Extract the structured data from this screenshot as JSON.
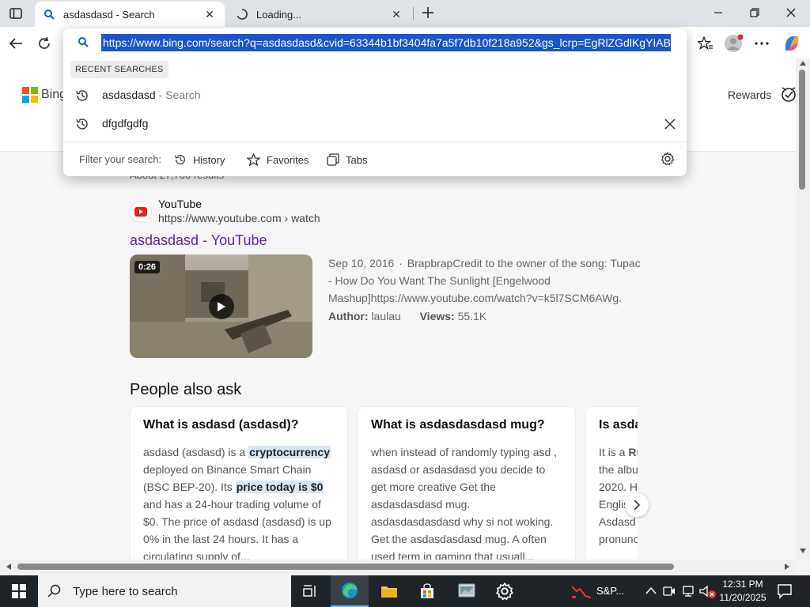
{
  "tabs": [
    {
      "title": "asdasdasd - Search",
      "active": true
    },
    {
      "title": "Loading...",
      "active": false
    }
  ],
  "omnibox": {
    "url": "https://www.bing.com/search?q=asdasdasd&cvid=63344b1bf3404fa7a5f7db10f218a952&gs_lcrp=EgRlZGdlKgYIABB",
    "recent_label": "RECENT SEARCHES",
    "suggestions": [
      {
        "text": "asdasdasd",
        "sub": " - Search"
      },
      {
        "text": "dfgdfgdfg",
        "sub": ""
      }
    ],
    "filter_label": "Filter your search:",
    "filters": [
      "History",
      "Favorites",
      "Tabs"
    ]
  },
  "bing": {
    "logo_text": "Bing",
    "rewards": "Rewards",
    "result_count": "About 27,700 results"
  },
  "result": {
    "site_name": "YouTube",
    "url": "https://www.youtube.com › watch",
    "title": "asdasdasd - YouTube",
    "duration": "0:26",
    "date": "Sep 10, 2016",
    "snippet": "BrapbrapCredit to the owner of the song: Tupac - How Do You Want The Sunlight [Engelwood Mashup]https://www.youtube.com/watch?v=k5l7SCM6AWg.",
    "author_label": "Author:",
    "author": "laulau",
    "views_label": "Views:",
    "views": "55.1K"
  },
  "paa": {
    "heading": "People also ask",
    "cards": [
      {
        "question": "What is asdasd (asdasd)?",
        "a1": "asdasd (asdasd) is a ",
        "h1": "cryptocurrency",
        "a2": " deployed on Binance Smart Chain (BSC BEP-20). Its ",
        "h2": "price today is $0",
        "a3": " and has a 24-hour trading volume of $0. The price of asdasd (asdasd) is up 0% in the last 24 hours. It has a circulating supply of..."
      },
      {
        "question": "What is asdasdasdasd mug?",
        "a1": "when instead of randomly typing asd , asdasd or asdasdasd you decide to get more creative Get the asdasdasdasd mug. asdasdasdasdasd why si not woking. Get the asdasdasdasd mug. A often used term in gaming that usuall...",
        "h1": "",
        "a2": "",
        "h2": "",
        "a3": ""
      },
      {
        "question": "Is asda",
        "a1": "It is a ",
        "h1": "Ru",
        "a2": " the albu 2020. H Englis Asdasd pronunc",
        "h2": "",
        "a3": ""
      }
    ]
  },
  "taskbar": {
    "search_placeholder": "Type here to search",
    "widget_text": "S&P...",
    "time": "12:31 PM",
    "date": "11/20/2025"
  },
  "colors": {
    "url_highlight": "#1a56c9",
    "visited_link": "#5e239d",
    "answer_highlight": "#d9e6f5",
    "taskbar_bg": "#1f2428"
  }
}
